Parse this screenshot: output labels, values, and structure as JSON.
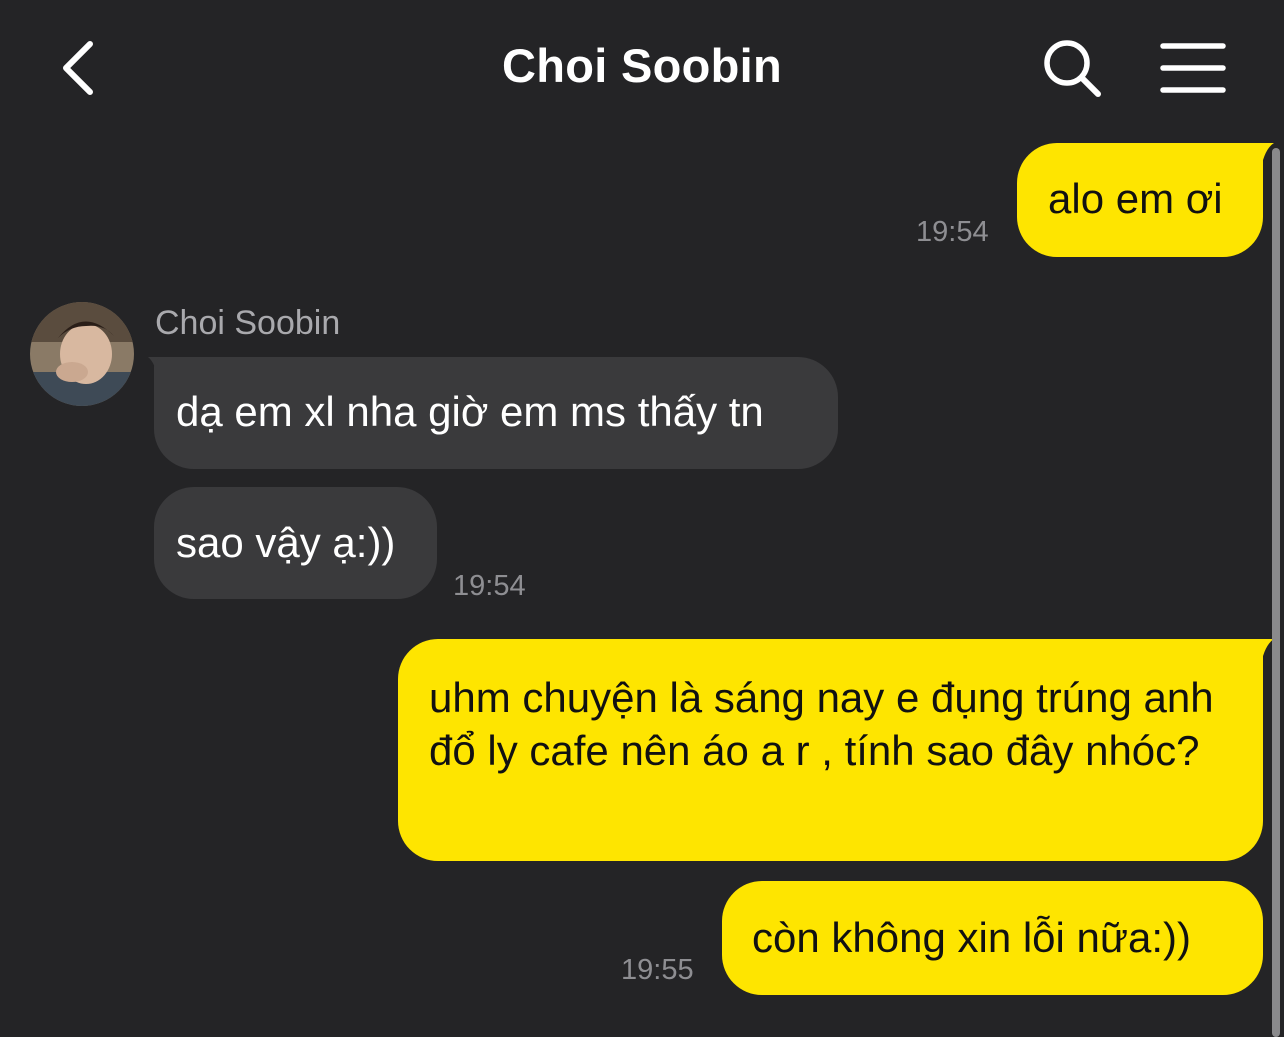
{
  "header": {
    "title": "Choi Soobin",
    "back_icon": "chevron-left-icon",
    "search_icon": "search-icon",
    "menu_icon": "hamburger-menu-icon"
  },
  "colors": {
    "background": "#242426",
    "outgoing_bubble": "#fee500",
    "incoming_bubble": "#3a3a3c",
    "timestamp": "#8e8e92"
  },
  "contact": {
    "name": "Choi Soobin"
  },
  "messages": [
    {
      "sender": "me",
      "text": "alo em ơi",
      "time": "19:54"
    },
    {
      "sender": "them",
      "text": "dạ em xl nha giờ em ms thấy tn",
      "time": ""
    },
    {
      "sender": "them",
      "text": "sao vậy ạ:))",
      "time": "19:54"
    },
    {
      "sender": "me",
      "text": "uhm chuyện là sáng nay e đụng trúng anh đổ ly cafe nên áo a r , tính sao đây nhóc?",
      "time": ""
    },
    {
      "sender": "me",
      "text": "còn không xin lỗi nữa:))",
      "time": "19:55"
    }
  ]
}
